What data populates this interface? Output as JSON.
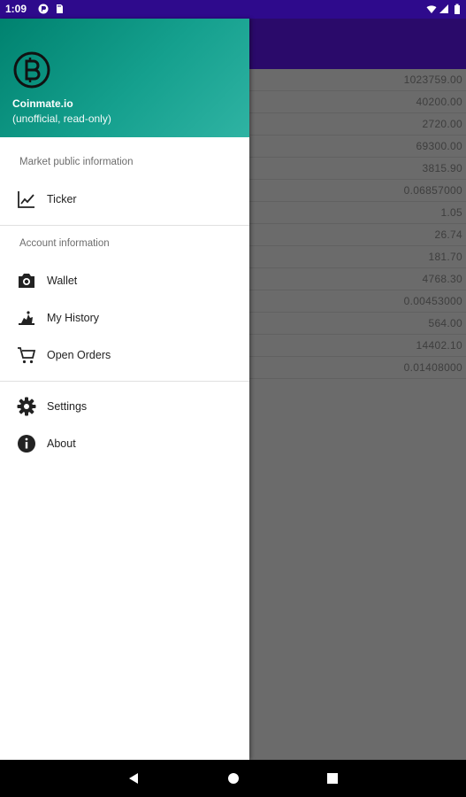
{
  "status_bar": {
    "time": "1:09"
  },
  "drawer": {
    "header": {
      "title": "Coinmate.io",
      "subtitle": "(unofficial, read-only)"
    },
    "sections": [
      {
        "title": "Market public information"
      },
      {
        "title": "Account information"
      }
    ],
    "items": {
      "ticker": {
        "label": "Ticker",
        "icon": "chart-line-icon"
      },
      "wallet": {
        "label": "Wallet",
        "icon": "camera-icon"
      },
      "history": {
        "label": "My History",
        "icon": "history-icon"
      },
      "orders": {
        "label": "Open Orders",
        "icon": "cart-icon"
      },
      "settings": {
        "label": "Settings",
        "icon": "gear-icon"
      },
      "about": {
        "label": "About",
        "icon": "info-icon"
      }
    }
  },
  "list_values": [
    "1023759.00",
    "40200.00",
    "2720.00",
    "69300.00",
    "3815.90",
    "0.06857000",
    "1.05",
    "26.74",
    "181.70",
    "4768.30",
    "0.00453000",
    "564.00",
    "14402.10",
    "0.01408000"
  ],
  "colors": {
    "header_gradient_start": "#00826f",
    "header_gradient_end": "#2fb3a3",
    "app_bar": "#2a0a6a",
    "status_bar": "#2e0a8c"
  }
}
